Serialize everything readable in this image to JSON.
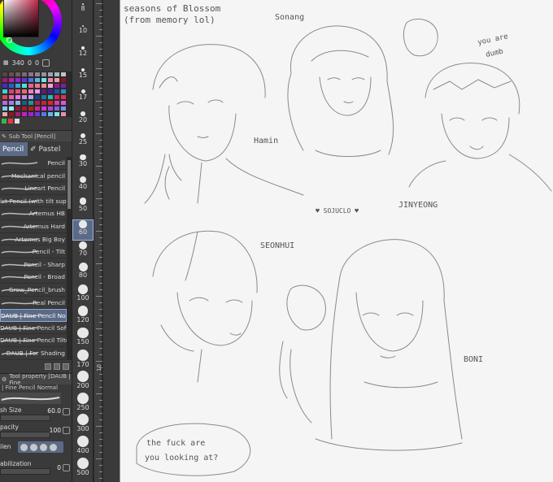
{
  "colors": {
    "selected_color": "#c62a4e",
    "selection_accent": "#5b6b87",
    "panel_bg": "#3a3a3a",
    "canvas_bg": "#f5f5f5"
  },
  "color_panel": {
    "value_a": "340",
    "value_b": "0",
    "value_c": "0"
  },
  "subtool_panel": {
    "header": "Sub Tool [Pencil]",
    "tabs": [
      {
        "label": "Pencil",
        "icon": "pencil-icon"
      },
      {
        "label": "Pastel",
        "icon": "pastel-icon"
      }
    ],
    "brushes": [
      {
        "label": "Pencil"
      },
      {
        "label": "Mechanical pencil"
      },
      {
        "label": "Lineart Pencil"
      },
      {
        "label": "ict Pencil (with tilt support)"
      },
      {
        "label": "Artemus HB"
      },
      {
        "label": "Artemus Hard"
      },
      {
        "label": "Artemus Big Boy"
      },
      {
        "label": "Pencil - Tilt"
      },
      {
        "label": "Pencil - Sharp"
      },
      {
        "label": "Pencil - Broad"
      },
      {
        "label": "Grow_Pencil_brush"
      },
      {
        "label": "Real Pencil"
      },
      {
        "label": "DAUB | Fine Pencil Normal",
        "selected": true
      },
      {
        "label": "DAUB | Fine Pencil Soft"
      },
      {
        "label": "DAUB | Fine Pencil Tilted"
      },
      {
        "label": "DAUB | For Shading"
      }
    ]
  },
  "tool_property": {
    "header": "Tool property [DAUB | Fine",
    "name": "| Fine Pencil Normal",
    "brush_size_label": "sh Size",
    "brush_size_value": "60.0",
    "opacity_label": "pacity",
    "opacity_value": "100",
    "blend_label": "ilen",
    "stabilization_label": "abilization",
    "stabilization_value": "0"
  },
  "size_strip": {
    "sizes": [
      {
        "label": "8"
      },
      {
        "label": "10"
      },
      {
        "label": "12"
      },
      {
        "label": "15"
      },
      {
        "label": "17"
      },
      {
        "label": "20"
      },
      {
        "label": "25"
      },
      {
        "label": "30"
      },
      {
        "label": "40"
      },
      {
        "label": "50"
      },
      {
        "label": "60",
        "selected": true
      },
      {
        "label": "70"
      },
      {
        "label": "80"
      },
      {
        "label": "100"
      },
      {
        "label": "120"
      },
      {
        "label": "150"
      },
      {
        "label": "170"
      },
      {
        "label": "200"
      },
      {
        "label": "250"
      },
      {
        "label": "300"
      },
      {
        "label": "400"
      },
      {
        "label": "500"
      }
    ]
  },
  "ruler": {
    "label": "10"
  },
  "canvas": {
    "title_line1": "seasons of Blossom",
    "title_line2": "(from memory lol)",
    "names": {
      "sonang": "Sonang",
      "hamin": "Hamin",
      "jinyeong": "JINYEONG",
      "seonhui": "SEONHUI",
      "boni": "BONI"
    },
    "signature": "♥ SOJUCLO ♥",
    "bubble_right_1": "you are",
    "bubble_right_2": "dumb",
    "bubble_bottom_1": "the fuck are",
    "bubble_bottom_2": "you looking at?"
  }
}
